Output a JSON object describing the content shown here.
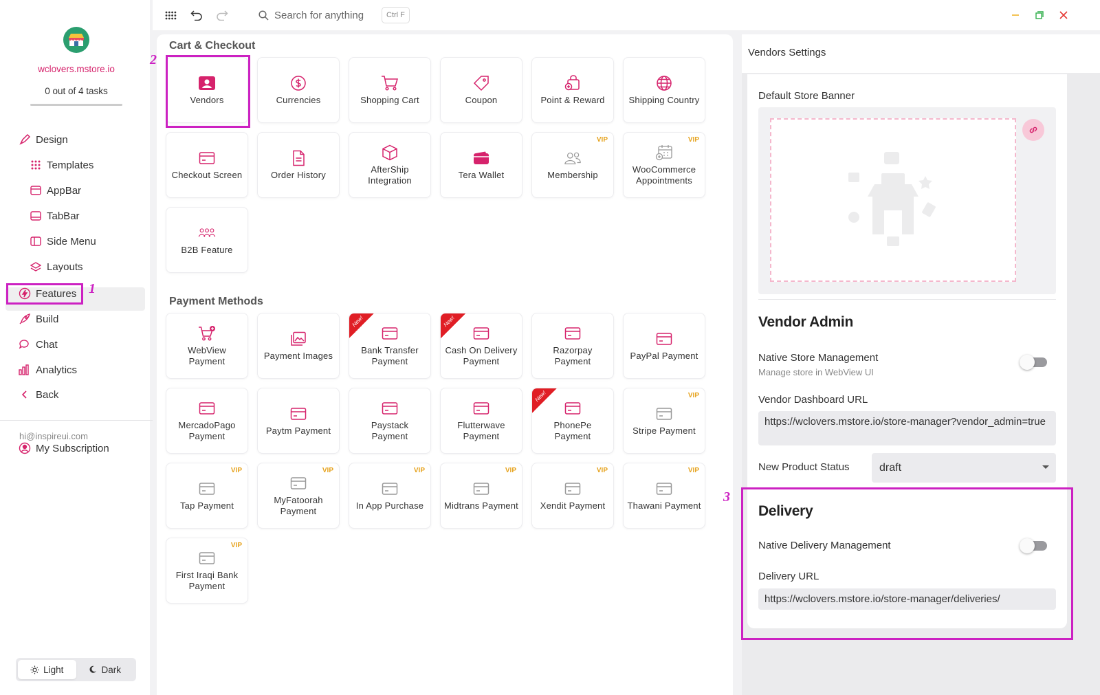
{
  "sidebar": {
    "store_name": "wclovers.mstore.io",
    "tasks": "0 out of 4 tasks",
    "tasks_progress": 0,
    "nav": {
      "design": "Design",
      "templates": "Templates",
      "appbar": "AppBar",
      "tabbar": "TabBar",
      "side_menu": "Side Menu",
      "layouts": "Layouts",
      "features": "Features",
      "build": "Build",
      "chat": "Chat",
      "analytics": "Analytics",
      "back": "Back"
    },
    "email": "hi@inspireui.com",
    "subscription": "My Subscription",
    "theme": {
      "light": "Light",
      "dark": "Dark",
      "selected": "Light"
    }
  },
  "topbar": {
    "search_placeholder": "Search for anything",
    "shortcut": "Ctrl F"
  },
  "main": {
    "cart_section_title": "Cart & Checkout",
    "payment_section_title": "Payment Methods",
    "cart_cards": [
      {
        "label": "Vendors",
        "icon": "vendor-icon"
      },
      {
        "label": "Currencies",
        "icon": "currency-icon"
      },
      {
        "label": "Shopping Cart",
        "icon": "cart-icon"
      },
      {
        "label": "Coupon",
        "icon": "tag-icon"
      },
      {
        "label": "Point & Reward",
        "icon": "reward-icon"
      },
      {
        "label": "Shipping Country",
        "icon": "globe-icon"
      },
      {
        "label": "Checkout Screen",
        "icon": "card-icon"
      },
      {
        "label": "Order History",
        "icon": "document-icon"
      },
      {
        "label": "AfterShip Integration",
        "icon": "box-icon"
      },
      {
        "label": "Tera Wallet",
        "icon": "wallet-icon"
      },
      {
        "label": "Membership",
        "icon": "members-icon",
        "badge": "VIP"
      },
      {
        "label": "WooCommerce Appointments",
        "icon": "calendar-icon",
        "badge": "VIP"
      },
      {
        "label": "B2B Feature",
        "icon": "group-icon"
      }
    ],
    "payment_cards": [
      {
        "label": "WebView Payment",
        "icon": "cart-plus-icon"
      },
      {
        "label": "Payment Images",
        "icon": "images-icon"
      },
      {
        "label": "Bank Transfer Payment",
        "icon": "card-icon",
        "ribbon": "New!"
      },
      {
        "label": "Cash On Delivery Payment",
        "icon": "card-icon",
        "ribbon": "New!"
      },
      {
        "label": "Razorpay Payment",
        "icon": "card-icon"
      },
      {
        "label": "PayPal Payment",
        "icon": "card-icon"
      },
      {
        "label": "MercadoPago Payment",
        "icon": "card-icon"
      },
      {
        "label": "Paytm Payment",
        "icon": "card-icon"
      },
      {
        "label": "Paystack Payment",
        "icon": "card-icon"
      },
      {
        "label": "Flutterwave Payment",
        "icon": "card-icon"
      },
      {
        "label": "PhonePe Payment",
        "icon": "card-icon",
        "ribbon": "New!"
      },
      {
        "label": "Stripe Payment",
        "icon": "card-icon",
        "badge": "VIP"
      },
      {
        "label": "Tap Payment",
        "icon": "card-icon",
        "badge": "VIP"
      },
      {
        "label": "MyFatoorah Payment",
        "icon": "card-icon",
        "badge": "VIP"
      },
      {
        "label": "In App Purchase",
        "icon": "card-icon",
        "badge": "VIP"
      },
      {
        "label": "Midtrans Payment",
        "icon": "card-icon",
        "badge": "VIP"
      },
      {
        "label": "Xendit Payment",
        "icon": "card-icon",
        "badge": "VIP"
      },
      {
        "label": "Thawani Payment",
        "icon": "card-icon",
        "badge": "VIP"
      },
      {
        "label": "First Iraqi Bank Payment",
        "icon": "card-icon",
        "badge": "VIP"
      }
    ]
  },
  "settings": {
    "title": "Vendors Settings",
    "default_banner_label": "Default Store Banner",
    "vendor_admin": {
      "heading": "Vendor Admin",
      "native_store_label": "Native Store Management",
      "native_store_sub": "Manage store in WebView UI",
      "native_store_enabled": false,
      "dashboard_url_label": "Vendor Dashboard URL",
      "dashboard_url_value": "https://wclovers.mstore.io/store-manager?vendor_admin=true",
      "product_status_label": "New Product Status",
      "product_status_value": "draft"
    },
    "delivery": {
      "heading": "Delivery",
      "native_delivery_label": "Native Delivery Management",
      "native_delivery_enabled": false,
      "delivery_url_label": "Delivery URL",
      "delivery_url_value": "https://wclovers.mstore.io/store-manager/deliveries/"
    }
  },
  "annotations": {
    "one": "1",
    "two": "2",
    "three": "3"
  },
  "colors": {
    "accent": "#d6236c",
    "highlight": "#cc21c2",
    "vip": "#e6a21c",
    "ribbon": "#e01e25",
    "logo": "#2b9e6f"
  }
}
